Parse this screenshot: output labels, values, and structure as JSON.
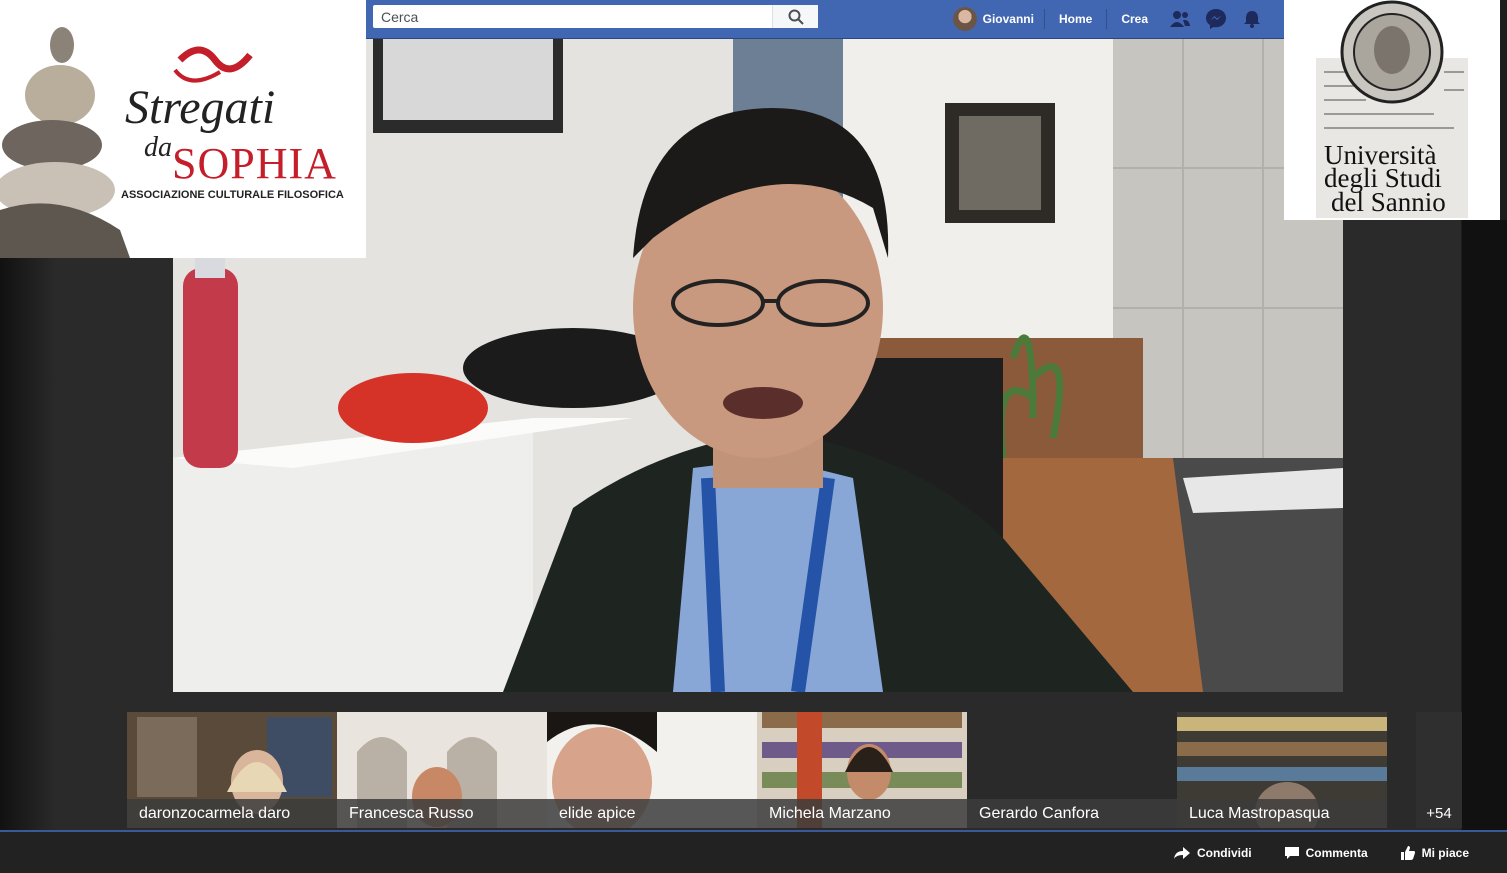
{
  "search": {
    "placeholder": "Cerca"
  },
  "nav": {
    "user": "Giovanni",
    "home": "Home",
    "create": "Crea"
  },
  "logo_left": {
    "title_line1": "Stregati",
    "title_da": "da",
    "title_line2": "SOPHIA",
    "subtitle": "ASSOCIAZIONE CULTURALE FILOSOFICA"
  },
  "logo_right": {
    "line1": "Università",
    "line2": "degli Studi",
    "line3": "del Sannio"
  },
  "participants": [
    {
      "name": "daronzocarmela daro"
    },
    {
      "name": "Francesca Russo"
    },
    {
      "name": "elide apice"
    },
    {
      "name": "Michela Marzano"
    },
    {
      "name": "Gerardo Canfora"
    },
    {
      "name": "Luca Mastropasqua"
    }
  ],
  "more_count": "+54",
  "actions": {
    "share": "Condividi",
    "comment": "Commenta",
    "like": "Mi piace"
  },
  "colors": {
    "fb_blue": "#4267b2",
    "logo_red": "#c41e2a"
  }
}
